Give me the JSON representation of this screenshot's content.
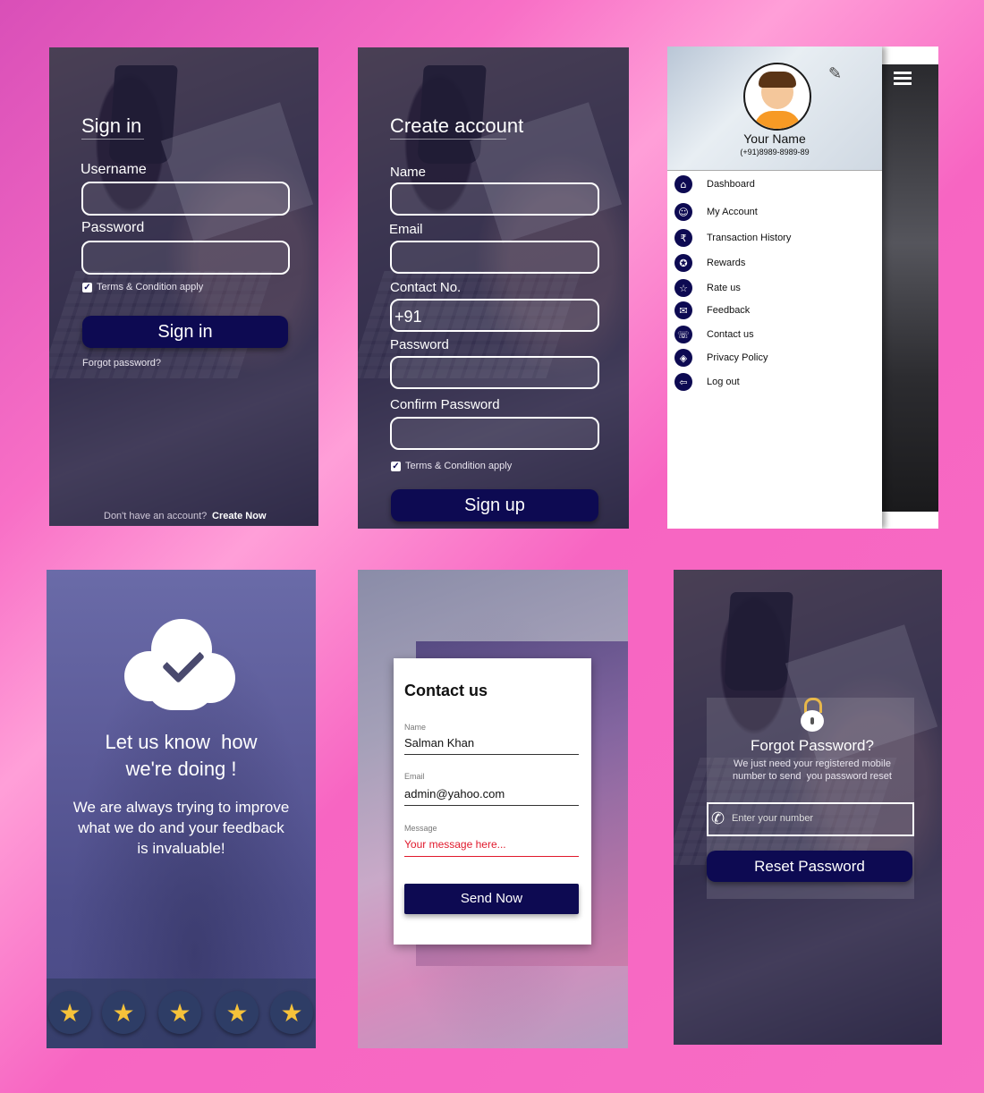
{
  "signin": {
    "title": "Sign in",
    "username_label": "Username",
    "password_label": "Password",
    "terms": "Terms & Condition apply",
    "button": "Sign in",
    "forgot": "Forgot password?",
    "no_account": "Don't have an account?",
    "create_now": "Create Now"
  },
  "signup": {
    "title": "Create account",
    "name_label": "Name",
    "email_label": "Email",
    "contact_label": "Contact No.",
    "contact_prefix": "+91",
    "password_label": "Password",
    "confirm_label": "Confirm Password",
    "terms": "Terms & Condition apply",
    "button": "Sign up"
  },
  "drawer": {
    "name": "Your Name",
    "phone": "(+91)8989-8989-89",
    "items": [
      {
        "label": "Dashboard",
        "icon": "home-icon"
      },
      {
        "label": "My Account",
        "icon": "user-icon"
      },
      {
        "label": "Transaction History",
        "icon": "money-icon"
      },
      {
        "label": "Rewards",
        "icon": "award-icon"
      },
      {
        "label": "Rate us",
        "icon": "star-icon"
      },
      {
        "label": "Feedback",
        "icon": "feedback-icon"
      },
      {
        "label": "Contact us",
        "icon": "phone-icon"
      },
      {
        "label": "Privacy Policy",
        "icon": "shield-icon"
      },
      {
        "label": "Log out",
        "icon": "logout-icon"
      }
    ]
  },
  "feedback": {
    "heading_line1": "Let us know  how",
    "heading_line2": "we're doing !",
    "body_line1": "We are always trying to improve",
    "body_line2": "what we do and your feedback",
    "body_line3": "is invaluable!",
    "rating_stars": 5
  },
  "contact": {
    "title": "Contact us",
    "name_label": "Name",
    "name_value": "Salman Khan",
    "email_label": "Email",
    "email_value": "admin@yahoo.com",
    "message_label": "Message",
    "message_placeholder": "Your message here...",
    "button": "Send Now"
  },
  "forgot": {
    "title": "Forgot Password?",
    "desc_line1": "We just need your registered mobile",
    "desc_line2": "number to send  you password reset",
    "placeholder": "Enter your number",
    "button": "Reset Password"
  },
  "colors": {
    "navy": "#0d0a52",
    "pink_bg": "#f76dc4",
    "error_red": "#e0192c",
    "star_gold": "#f6c23a"
  }
}
